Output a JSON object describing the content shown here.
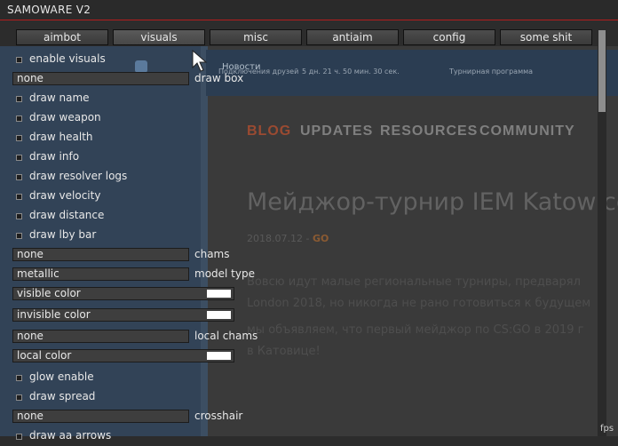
{
  "window": {
    "title": "SAMOWARE V2"
  },
  "tabs": [
    {
      "label": "aimbot"
    },
    {
      "label": "visuals"
    },
    {
      "label": "misc"
    },
    {
      "label": "antiaim"
    },
    {
      "label": "config"
    },
    {
      "label": "some shit"
    }
  ],
  "active_tab": "visuals",
  "visuals": {
    "enable_visuals": "enable visuals",
    "draw_box": {
      "value": "none",
      "label": "draw box"
    },
    "draw_name": "draw name",
    "draw_weapon": "draw weapon",
    "draw_health": "draw health",
    "draw_info": "draw info",
    "draw_resolver_logs": "draw resolver logs",
    "draw_velocity": "draw velocity",
    "draw_distance": "draw distance",
    "draw_lby_bar": "draw lby bar",
    "chams": {
      "value": "none",
      "label": "chams"
    },
    "model_type": {
      "value": "metallic",
      "label": "model type"
    },
    "visible_color": {
      "label": "visible color",
      "color": "#ffffff"
    },
    "invisible_color": {
      "label": "invisible color",
      "color": "#ffffff"
    },
    "local_chams": {
      "value": "none",
      "label": "local chams"
    },
    "local_color": {
      "label": "local color",
      "color": "#ffffff"
    },
    "glow_enable": "glow enable",
    "draw_spread": "draw spread",
    "crosshair": {
      "value": "none",
      "label": "crosshair"
    },
    "draw_aa_arrows": "draw aa arrows"
  },
  "overlay": {
    "fps_label": "fps"
  },
  "background_page": {
    "news_link": "Новости",
    "top_info_1": "Подключения друзей",
    "top_info_2": "5 дн. 21 ч. 50 мин. 30 сек.",
    "top_info_3": "Турнирная программа",
    "nav": [
      "BLOG",
      "UPDATES",
      "RESOURCES",
      "COMMUNITY"
    ],
    "headline": "Мейджор-турнир IEM Katowice",
    "date": "2018.07.12 -",
    "date_badge": "GO",
    "para_lines": [
      "Вовсю идут малые региональные турниры, предварял",
      "London 2018, но никогда не рано готовиться к будущем",
      "мы объявляем, что первый мейджор по CS:GO в 2019 г",
      "в Катовице!"
    ]
  },
  "colors": {
    "accent": "#b31d1d",
    "panel": "#3e3e3e",
    "swatch": "#ffffff"
  }
}
